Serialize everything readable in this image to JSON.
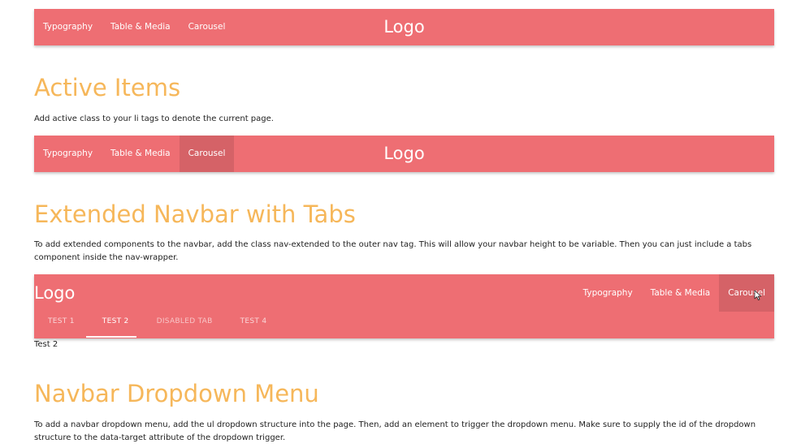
{
  "navbar1": {
    "links": [
      "Typography",
      "Table & Media",
      "Carousel"
    ],
    "logo": "Logo"
  },
  "section_active": {
    "heading": "Active Items",
    "text": "Add active class to your li tags to denote the current page."
  },
  "navbar2": {
    "links": [
      "Typography",
      "Table & Media",
      "Carousel"
    ],
    "active_link": "Carousel",
    "logo": "Logo"
  },
  "section_extended": {
    "heading": "Extended Navbar with Tabs",
    "text": "To add extended components to the navbar, add the class nav-extended to the outer nav tag. This will allow your navbar height to be variable. Then you can just include a tabs component inside the nav-wrapper."
  },
  "navbar3": {
    "logo": "Logo",
    "links": [
      "Typography",
      "Table & Media",
      "Carousel"
    ],
    "active_link": "Carousel",
    "tabs": [
      "TEST 1",
      "TEST 2",
      "DISABLED TAB",
      "TEST 4"
    ],
    "active_tab": "TEST 2",
    "disabled_tab": "DISABLED TAB"
  },
  "tab_content": "Test 2",
  "section_dropdown": {
    "heading": "Navbar Dropdown Menu",
    "text": "To add a navbar dropdown menu, add the ul dropdown structure into the page. Then, add an element to trigger the dropdown menu. Make sure to supply the id of the dropdown structure to the data-target attribute of the dropdown trigger."
  },
  "colors": {
    "navbar": "#ee6e73",
    "heading": "#f6b75a",
    "text": "#222222"
  }
}
